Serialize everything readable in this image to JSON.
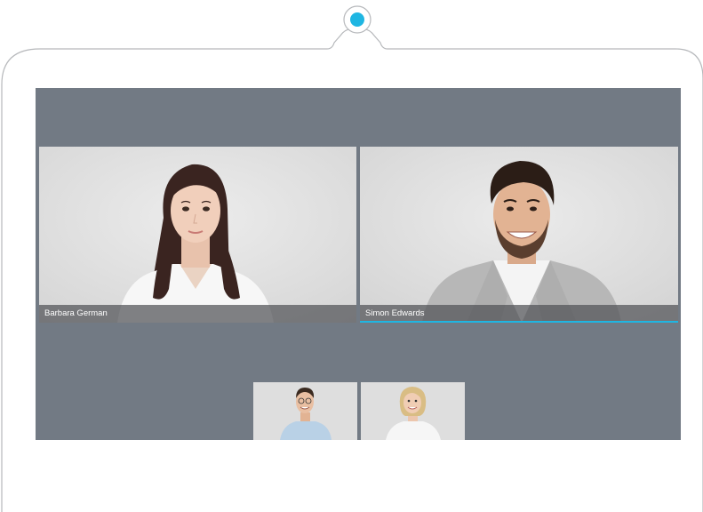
{
  "device": {
    "camera_indicator_color": "#1fb6e2",
    "screen_background": "#727a84"
  },
  "participants": [
    {
      "name": "Barbara German",
      "speaking": false
    },
    {
      "name": "Simon Edwards",
      "speaking": true
    }
  ],
  "self_view": [
    {
      "label": ""
    },
    {
      "label": ""
    }
  ],
  "active_speaker_color": "#1fb6e2"
}
